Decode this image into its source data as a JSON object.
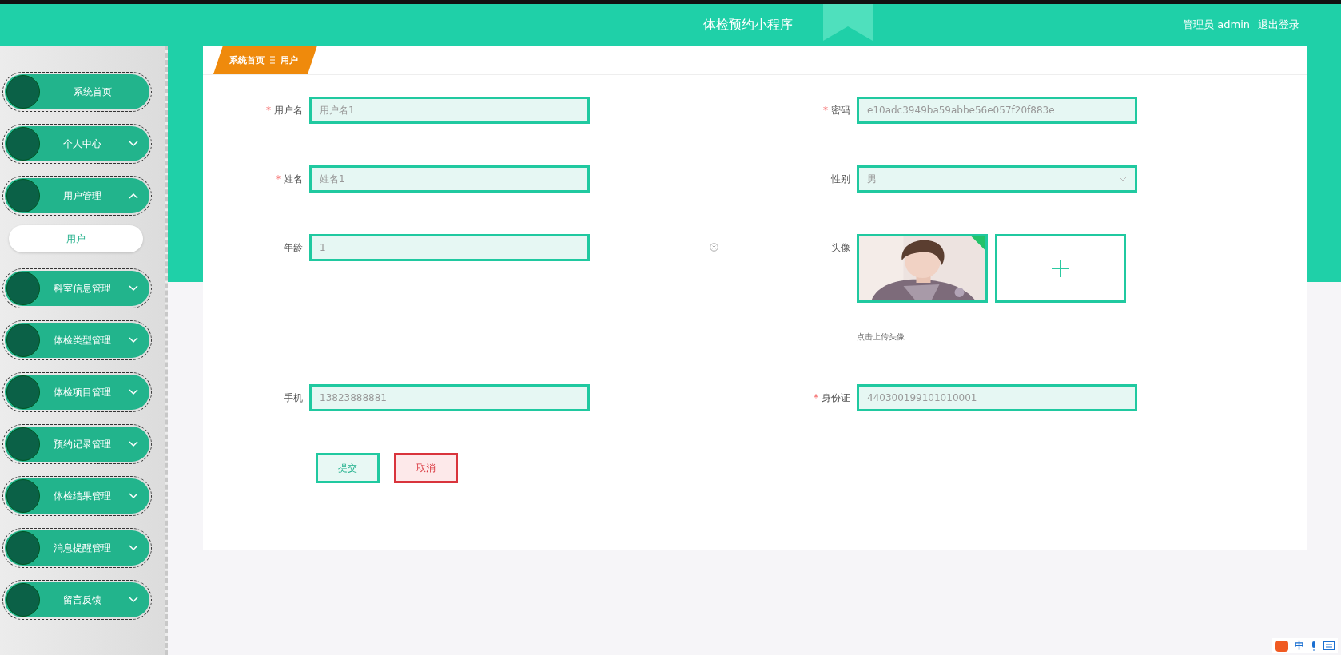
{
  "header": {
    "title": "体检预约小程序",
    "user": "管理员 admin",
    "logout": "退出登录"
  },
  "sidebar": {
    "items": [
      {
        "label": "系统首页",
        "selected": false
      },
      {
        "label": "个人中心",
        "selected": false,
        "expanded": false
      },
      {
        "label": "用户管理",
        "selected": false,
        "expanded": true,
        "children": [
          {
            "label": "用户",
            "selected": true
          }
        ]
      },
      {
        "label": "科室信息管理",
        "selected": false,
        "expanded": false
      },
      {
        "label": "体检类型管理",
        "selected": false,
        "expanded": false
      },
      {
        "label": "体检项目管理",
        "selected": false,
        "expanded": false
      },
      {
        "label": "预约记录管理",
        "selected": false,
        "expanded": false
      },
      {
        "label": "体检结果管理",
        "selected": false,
        "expanded": false
      },
      {
        "label": "消息提醒管理",
        "selected": false,
        "expanded": false
      },
      {
        "label": "留言反馈",
        "selected": false,
        "expanded": false
      }
    ]
  },
  "breadcrumb": [
    "系统首页",
    "用户"
  ],
  "form": {
    "rows": [
      {
        "left": {
          "kind": "input",
          "label": "用户名",
          "required_mark": "*",
          "placeholder": "用户名1"
        },
        "right": {
          "kind": "input",
          "label": "密码",
          "required_mark": "*",
          "value": "e10adc3949ba59abbe56e057f20f883e"
        }
      },
      {
        "left": {
          "kind": "input",
          "label": "姓名",
          "required_mark": "*",
          "placeholder": "姓名1"
        },
        "right": {
          "kind": "select",
          "label": "性别",
          "value": "男"
        }
      },
      {
        "left": {
          "kind": "input",
          "label": "年龄",
          "value": "1",
          "clearable": true
        },
        "right": {
          "kind": "upload",
          "label": "头像",
          "hint": "点击上传头像"
        }
      },
      {
        "left": {
          "kind": "input",
          "label": "手机",
          "value": "13823888881"
        },
        "right": {
          "kind": "input",
          "label": "身份证",
          "required_mark": "*",
          "value": "440300199101010001"
        }
      }
    ],
    "buttons": [
      {
        "kind": "submit",
        "label": "提交"
      },
      {
        "kind": "cancel",
        "label": "取消"
      }
    ]
  },
  "ime_bar": {
    "mode": "中"
  }
}
